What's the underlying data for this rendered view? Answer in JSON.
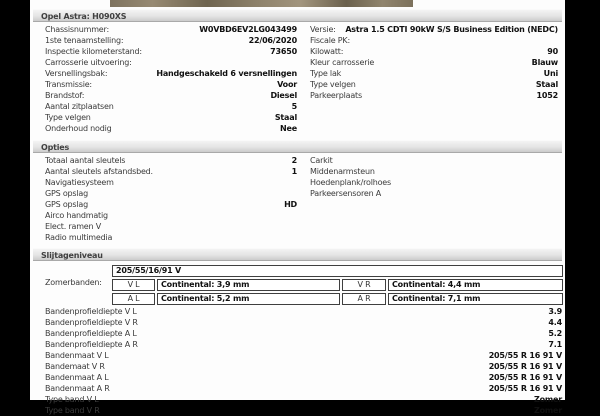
{
  "colors": {
    "margin_bg": "#000000",
    "page_bg": "#fdfdfd",
    "bar_gradient_top": "#f3f3f3",
    "bar_gradient_bottom": "#cccccc",
    "photo_tan": "#8d816a"
  },
  "vehicle_bar": {
    "title": "Opel Astra: H090XS"
  },
  "info": {
    "left": [
      {
        "label": "Chassisnummer:",
        "value": "W0VBD6EV2LG043499"
      },
      {
        "label": "1ste tenaamstelling:",
        "value": "22/06/2020"
      },
      {
        "label": "Inspectie kilometerstand:",
        "value": "73650"
      },
      {
        "label": "Carrosserie uitvoering:",
        "value": ""
      },
      {
        "label": "Versnellingsbak:",
        "value": "Handgeschakeld 6 versnellingen"
      },
      {
        "label": "Transmissie:",
        "value": "Voor"
      },
      {
        "label": "Brandstof:",
        "value": "Diesel"
      },
      {
        "label": "Aantal zitplaatsen",
        "value": "5"
      },
      {
        "label": "Type velgen",
        "value": "Staal"
      },
      {
        "label": "Onderhoud nodig",
        "value": "Nee"
      }
    ],
    "right": [
      {
        "label": "Versie:",
        "value": "Astra 1.5 CDTI 90kW S/S Business Edition (NEDC)"
      },
      {
        "label": "Fiscale PK:",
        "value": ""
      },
      {
        "label": "Kilowatt:",
        "value": "90"
      },
      {
        "label": "Kleur carrosserie",
        "value": "Blauw"
      },
      {
        "label": "Type lak",
        "value": "Uni"
      },
      {
        "label": "Type velgen",
        "value": "Staal"
      },
      {
        "label": "Parkeerplaats",
        "value": "1052"
      }
    ]
  },
  "opties": {
    "title": "Opties",
    "left": [
      {
        "label": "Totaal aantal sleutels",
        "value": "2"
      },
      {
        "label": "Aantal sleutels afstandsbed.",
        "value": "1"
      },
      {
        "label": "Navigatiesysteem",
        "value": ""
      },
      {
        "label": "GPS opslag",
        "value": ""
      },
      {
        "label": "GPS opslag",
        "value": "HD"
      },
      {
        "label": "Airco handmatig",
        "value": ""
      },
      {
        "label": "Elect. ramen V",
        "value": ""
      },
      {
        "label": "Radio multimedia",
        "value": ""
      }
    ],
    "right": [
      {
        "label": "Carkit"
      },
      {
        "label": "Middenarmsteun"
      },
      {
        "label": "Hoedenplank/rolhoes"
      },
      {
        "label": "Parkeersensoren A"
      }
    ]
  },
  "slijtage": {
    "title": "Slijtageniveau",
    "zomerbanden_label": "Zomerbanden:",
    "tire_table": {
      "size_header": "205/55/16/91 V",
      "rows": [
        {
          "pos1": "V L",
          "val1": "Continental: 3,9 mm",
          "pos2": "V R",
          "val2": "Continental: 4,4 mm"
        },
        {
          "pos1": "A L",
          "val1": "Continental: 5,2 mm",
          "pos2": "A R",
          "val2": "Continental: 7,1 mm"
        }
      ]
    },
    "rows": [
      {
        "label": "Bandenprofieldiepte V L",
        "value": "3.9"
      },
      {
        "label": "Bandenprofieldiepte V R",
        "value": "4.4"
      },
      {
        "label": "Bandenprofieldiepte A L",
        "value": "5.2"
      },
      {
        "label": "Bandenprofieldiepte A R",
        "value": "7.1"
      },
      {
        "label": "Bandenmaat V L",
        "value": "205/55 R 16 91 V"
      },
      {
        "label": "Bandemaat V R",
        "value": "205/55 R 16 91 V"
      },
      {
        "label": "Bandenmaat A L",
        "value": "205/55 R 16 91 V"
      },
      {
        "label": "Bandenmaat A R",
        "value": "205/55 R 16 91 V"
      },
      {
        "label": "Type band V L",
        "value": "Zomer"
      },
      {
        "label": "Type band V R",
        "value": "Zomer"
      }
    ]
  }
}
